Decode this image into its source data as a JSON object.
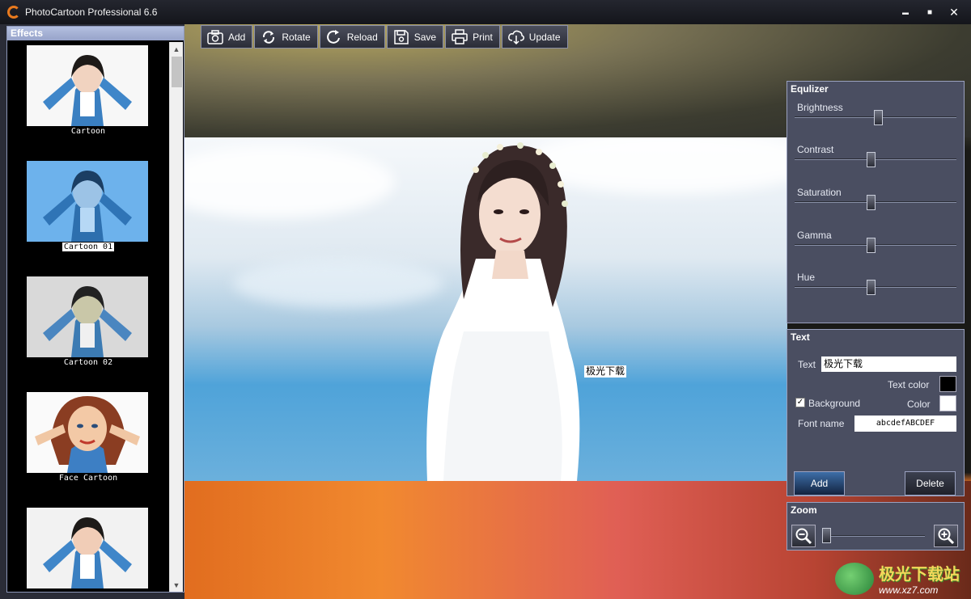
{
  "window": {
    "title": "PhotoCartoon Professional 6.6",
    "minimize": "▬",
    "maximize": "■",
    "close": "✕"
  },
  "effects": {
    "header": "Effects",
    "items": [
      {
        "label": "Cartoon",
        "selected": false
      },
      {
        "label": "Cartoon 01",
        "selected": true
      },
      {
        "label": "Cartoon 02",
        "selected": false
      },
      {
        "label": "Face Cartoon",
        "selected": false
      },
      {
        "label": "",
        "selected": false
      }
    ]
  },
  "toolbar": {
    "buttons": [
      {
        "label": "Add",
        "icon": "camera-icon"
      },
      {
        "label": "Rotate",
        "icon": "rotate-icon"
      },
      {
        "label": "Reload",
        "icon": "reload-icon"
      },
      {
        "label": "Save",
        "icon": "save-icon"
      },
      {
        "label": "Print",
        "icon": "print-icon"
      },
      {
        "label": "Update",
        "icon": "cloud-download-icon"
      }
    ]
  },
  "canvas": {
    "overlay_text": "极光下载"
  },
  "equalizer": {
    "title": "Equlizer",
    "sliders": [
      {
        "label": "Brightness",
        "value": 0.52
      },
      {
        "label": "Contrast",
        "value": 0.47
      },
      {
        "label": "Saturation",
        "value": 0.47
      },
      {
        "label": "Gamma",
        "value": 0.47
      },
      {
        "label": "Hue",
        "value": 0.47
      }
    ]
  },
  "text_panel": {
    "title": "Text",
    "text_label": "Text",
    "text_value": "极光下载",
    "text_color_label": "Text color",
    "text_color": "#000000",
    "background_label": "Background",
    "background_checked": true,
    "checkmark": "✓",
    "color_label": "Color",
    "background_color": "#ffffff",
    "font_name_label": "Font name",
    "font_sample": "abcdefABCDEF",
    "add_label": "Add",
    "delete_label": "Delete"
  },
  "zoom": {
    "title": "Zoom",
    "value": 0.0
  },
  "watermark": {
    "cn": "极光下载站",
    "url": "www.xz7.com"
  }
}
